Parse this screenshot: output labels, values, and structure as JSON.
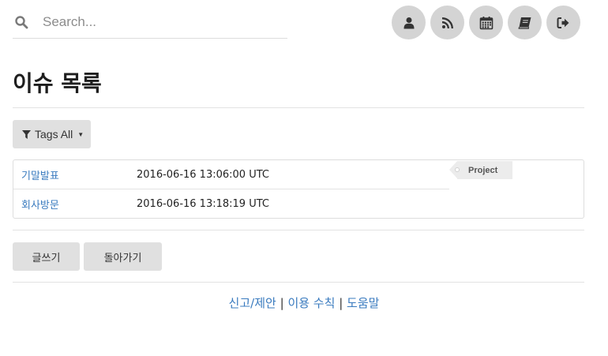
{
  "search": {
    "placeholder": "Search..."
  },
  "page_title": "이슈 목록",
  "tags_filter": {
    "label": "Tags All"
  },
  "issues": [
    {
      "title": "기말발표",
      "date": "2016-06-16 13:06:00 UTC"
    },
    {
      "title": "회사방문",
      "date": "2016-06-16 13:18:19 UTC"
    }
  ],
  "tag": {
    "label": "Project"
  },
  "actions": {
    "write": "글쓰기",
    "back": "돌아가기"
  },
  "footer": {
    "report": "신고/제안",
    "sep1": "|",
    "terms": "이용 수칙",
    "sep2": "|",
    "help": "도움말"
  },
  "toolbar_icons": [
    "user-icon",
    "rss-icon",
    "calendar-icon",
    "book-icon",
    "sign-out-icon"
  ],
  "colors": {
    "link": "#3a7bbf",
    "button_bg": "#e0e0e0",
    "icon_circle": "#d4d4d4"
  }
}
